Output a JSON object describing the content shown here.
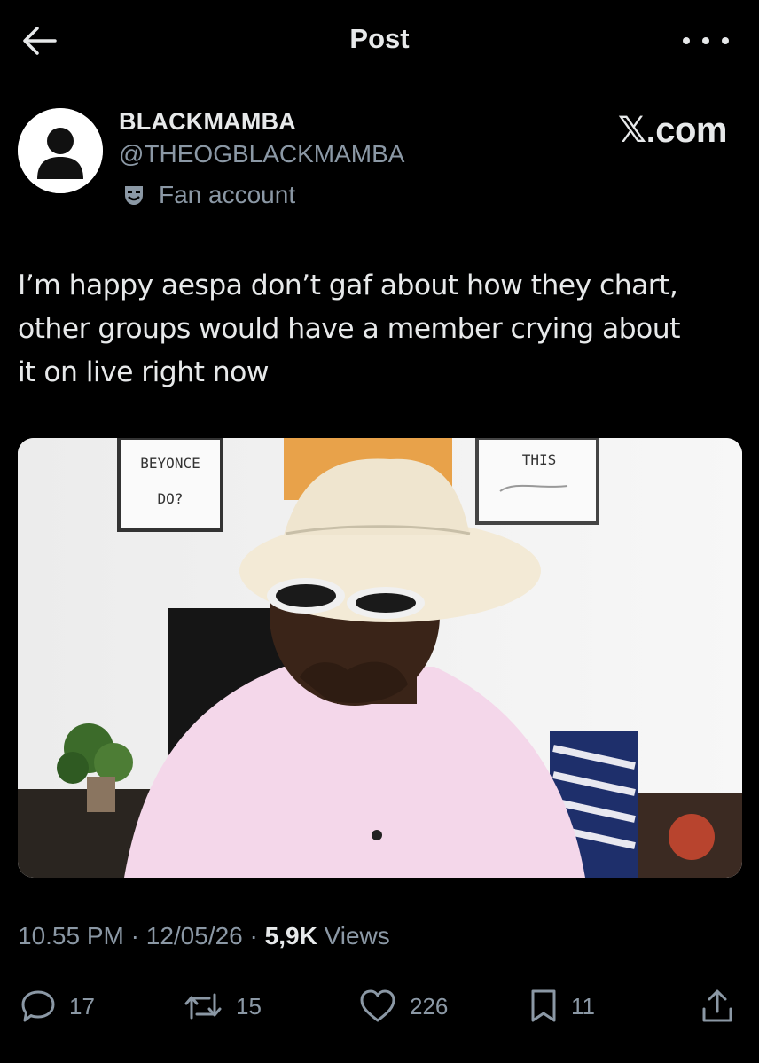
{
  "header": {
    "title": "Post",
    "back_icon": "arrow-left-icon",
    "more_icon": "more-horizontal-icon"
  },
  "author": {
    "name": "BLACKMAMBA",
    "handle": "@THEOGBLACKMAMBA",
    "badge_label": "Fan account",
    "badge_icon": "theater-mask-icon"
  },
  "watermark": "𝕏.com",
  "tweet": {
    "lines": [
      "I’m happy aespa don’t gaf about how they chart,",
      "other groups would have a member crying about",
      "it on live right now"
    ]
  },
  "media": {
    "frame_left": [
      "BEYONCE",
      "DO?"
    ],
    "frame_right": [
      "THIS"
    ]
  },
  "meta": {
    "time": "10.55 PM",
    "separator": "·",
    "date": "12/05/26",
    "views_count": "5,9K",
    "views_label": "Views"
  },
  "actions": {
    "replies": "17",
    "reposts": "15",
    "likes": "226",
    "bookmarks": "11"
  },
  "colors": {
    "background": "#000000",
    "text": "#e7e9ea",
    "secondary": "#8b98a5"
  }
}
